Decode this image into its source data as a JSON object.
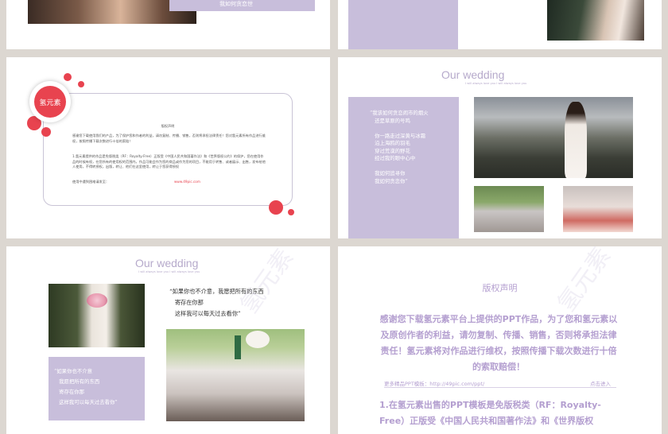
{
  "top_left": {
    "caption": "我如何贪恋世"
  },
  "mid_left": {
    "badge": "氢元素",
    "notice_title": "版权声明",
    "para1": "感谢您下载使用我们的产品，为了保护您和作者的利益，请勿复制、传播、销售，否则将承担法律责任！您对氢元素所有作品进行维权，按照传播下载次数进行十倍的索赔！",
    "para2": "1.氢元素提供的作品是免版税类（RF：Royalty-Free）正版受《中国人民共和国著作法》和《世界版权公约》的保护，您在使用作品的时候有权，在您所有的使用权的范围内，作品可能会作为您的商品或作为您的项目，不能用于转售、或者展示、出售，发布给他人使用，不得转授权，出版，转让、他们在这里使用，转让于您获得授权",
    "more_text": "使用中遇到困难请发至：",
    "link": "www.49pic.com"
  },
  "mid_right": {
    "title": "Our wedding",
    "subtitle": "I will always love you I will always love you",
    "poem": "“我该如何贪恋闹市的烟火\n   还是草原的号鸣\n\n   你一路走过深黄与冰霜\n   沿上海鸥的羽毛\n   穿过荒漠的野花\n   经过我的眼中心中\n\n   我如何追寻你\n   我如何贪恋你”"
  },
  "bot_left": {
    "title": "Our wedding",
    "subtitle": "I will always love you I will always love you",
    "quote": "“如果你也不介意，我愿把所有的东西\n   寄存在你那\n   这样我可以每天过去看你”",
    "poem": "“如果你也不介意\n   我愿把所有的东西\n   寄存在你那\n   这样我可以每天过去看你”"
  },
  "bot_right": {
    "title": "版权声明",
    "body": "感谢您下载氢元素平台上提供的PPT作品，为了您和氢元素以及原创作者的利益，请勿复制、传播、销售，否则将承担法律责任！氢元素将对作品进行维权，按照传播下载次数进行十倍的索取赔偿！",
    "more_label": "更多精品PPT模板：http://49pic.com/ppt/",
    "enter": "点击进入",
    "clause": "1.在氢元素出售的PPT模板是免版税类（RF：Royalty-Free）正版受《中国人民共和国著作法》和《世界版权"
  },
  "watermark": "氢元素",
  "colors": {
    "lavender": "#c8bedb",
    "red": "#e8434f",
    "purple_text": "#b49fd0",
    "background": "#dcd7d1"
  }
}
